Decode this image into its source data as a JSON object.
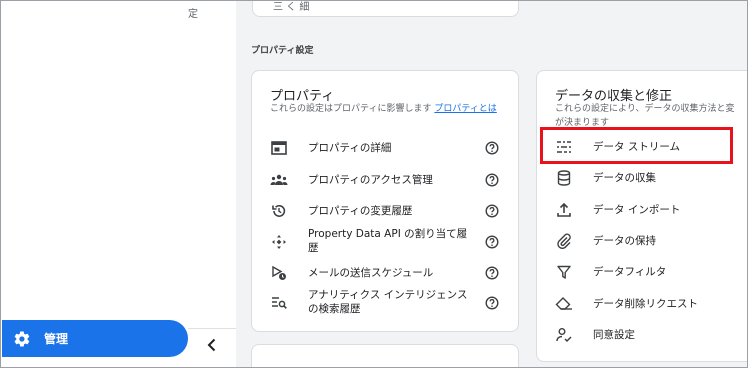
{
  "sidebar": {
    "cut_text": "定",
    "admin_label": "管理"
  },
  "main": {
    "top_card_fragment": "三 く 細",
    "section_title": "プロパティ設定",
    "property_card": {
      "title": "プロパティ",
      "desc": "これらの設定はプロパティに影響します",
      "link": "プロパティとは",
      "items": [
        {
          "label": "プロパティの詳細",
          "icon": "details-icon"
        },
        {
          "label": "プロパティのアクセス管理",
          "icon": "group-icon"
        },
        {
          "label": "プロパティの変更履歴",
          "icon": "history-icon"
        },
        {
          "label": "Property Data API の割り当て履歴",
          "icon": "api-icon"
        },
        {
          "label": "メールの送信スケジュール",
          "icon": "scheduled-email-icon"
        },
        {
          "label": "アナリティクス インテリジェンスの検索履歴",
          "icon": "search-history-icon"
        }
      ]
    },
    "data_card": {
      "title": "データの収集と修正",
      "desc_line1": "これらの設定により、データの収集方法と変",
      "desc_line2": "が決まります",
      "items": [
        {
          "label": "データ ストリーム",
          "icon": "data-stream-icon"
        },
        {
          "label": "データの収集",
          "icon": "database-icon"
        },
        {
          "label": "データ インポート",
          "icon": "upload-icon"
        },
        {
          "label": "データの保持",
          "icon": "paperclip-icon"
        },
        {
          "label": "データフィルタ",
          "icon": "filter-icon"
        },
        {
          "label": "データ削除リクエスト",
          "icon": "eraser-icon"
        },
        {
          "label": "同意設定",
          "icon": "consent-icon"
        }
      ]
    }
  },
  "colors": {
    "accent": "#1a73e8",
    "highlight": "#e8121c",
    "background": "#f1f3f4"
  }
}
